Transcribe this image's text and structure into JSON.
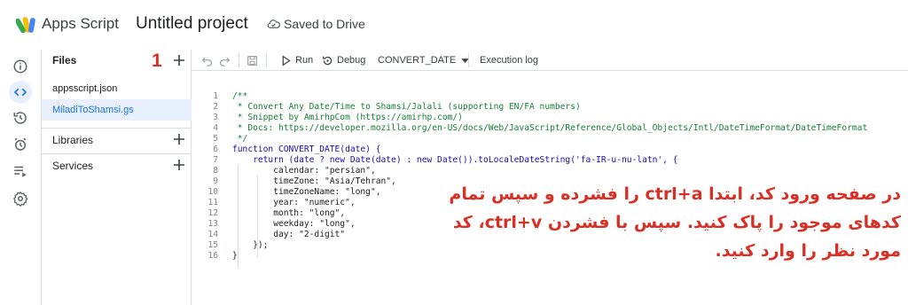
{
  "header": {
    "app_name": "Apps Script",
    "project_title": "Untitled project",
    "saved_status": "Saved to Drive"
  },
  "rail": {
    "icons": [
      "info-icon",
      "code-icon",
      "history-icon",
      "triggers-icon",
      "executions-icon",
      "settings-icon"
    ]
  },
  "files_panel": {
    "title": "Files",
    "step_number": "1",
    "files": [
      {
        "name": "appsscript.json",
        "selected": false
      },
      {
        "name": "MiladiToShamsi.gs",
        "selected": true
      }
    ],
    "sections": [
      {
        "label": "Libraries"
      },
      {
        "label": "Services"
      }
    ]
  },
  "toolbar": {
    "run_label": "Run",
    "debug_label": "Debug",
    "function_select": "CONVERT_DATE",
    "execution_log_label": "Execution log"
  },
  "editor": {
    "line_numbers": [
      "1",
      "2",
      "3",
      "4",
      "5",
      "6",
      "7",
      "8",
      "9",
      "10",
      "11",
      "12",
      "13",
      "14",
      "15",
      "16"
    ],
    "lines": [
      "/**",
      " * Convert Any Date/Time to Shamsi/Jalali (supporting EN/FA numbers)",
      " * Snippet by AmirhpCom (https://amirhp.com/)",
      " * Docs: https://developer.mozilla.org/en-US/docs/Web/JavaScript/Reference/Global_Objects/Intl/DateTimeFormat/DateTimeFormat",
      " */",
      "function CONVERT_DATE(date) {",
      "    return (date ? new Date(date) : new Date()).toLocaleDateString('fa-IR-u-nu-latn', {",
      "        calendar: \"persian\",",
      "        timeZone: \"Asia/Tehran\",",
      "        timeZoneName: \"long\",",
      "        year: \"numeric\",",
      "        month: \"long\",",
      "        weekday: \"long\",",
      "        day: \"2-digit\"",
      "    });",
      "}"
    ]
  },
  "annotation": {
    "line1": "در صفحه ورود کد، ابتدا ctrl+a را فشرده و سپس تمام",
    "line2": "کدهای موجود را پاک کنید. سپس با فشردن ctrl+v، کد",
    "line3": "مورد نظر را وارد کنید."
  },
  "colors": {
    "accent": "#1a73e8",
    "annotation": "#d93025",
    "selected_bg": "#e8f0fe",
    "comment": "#188038"
  }
}
